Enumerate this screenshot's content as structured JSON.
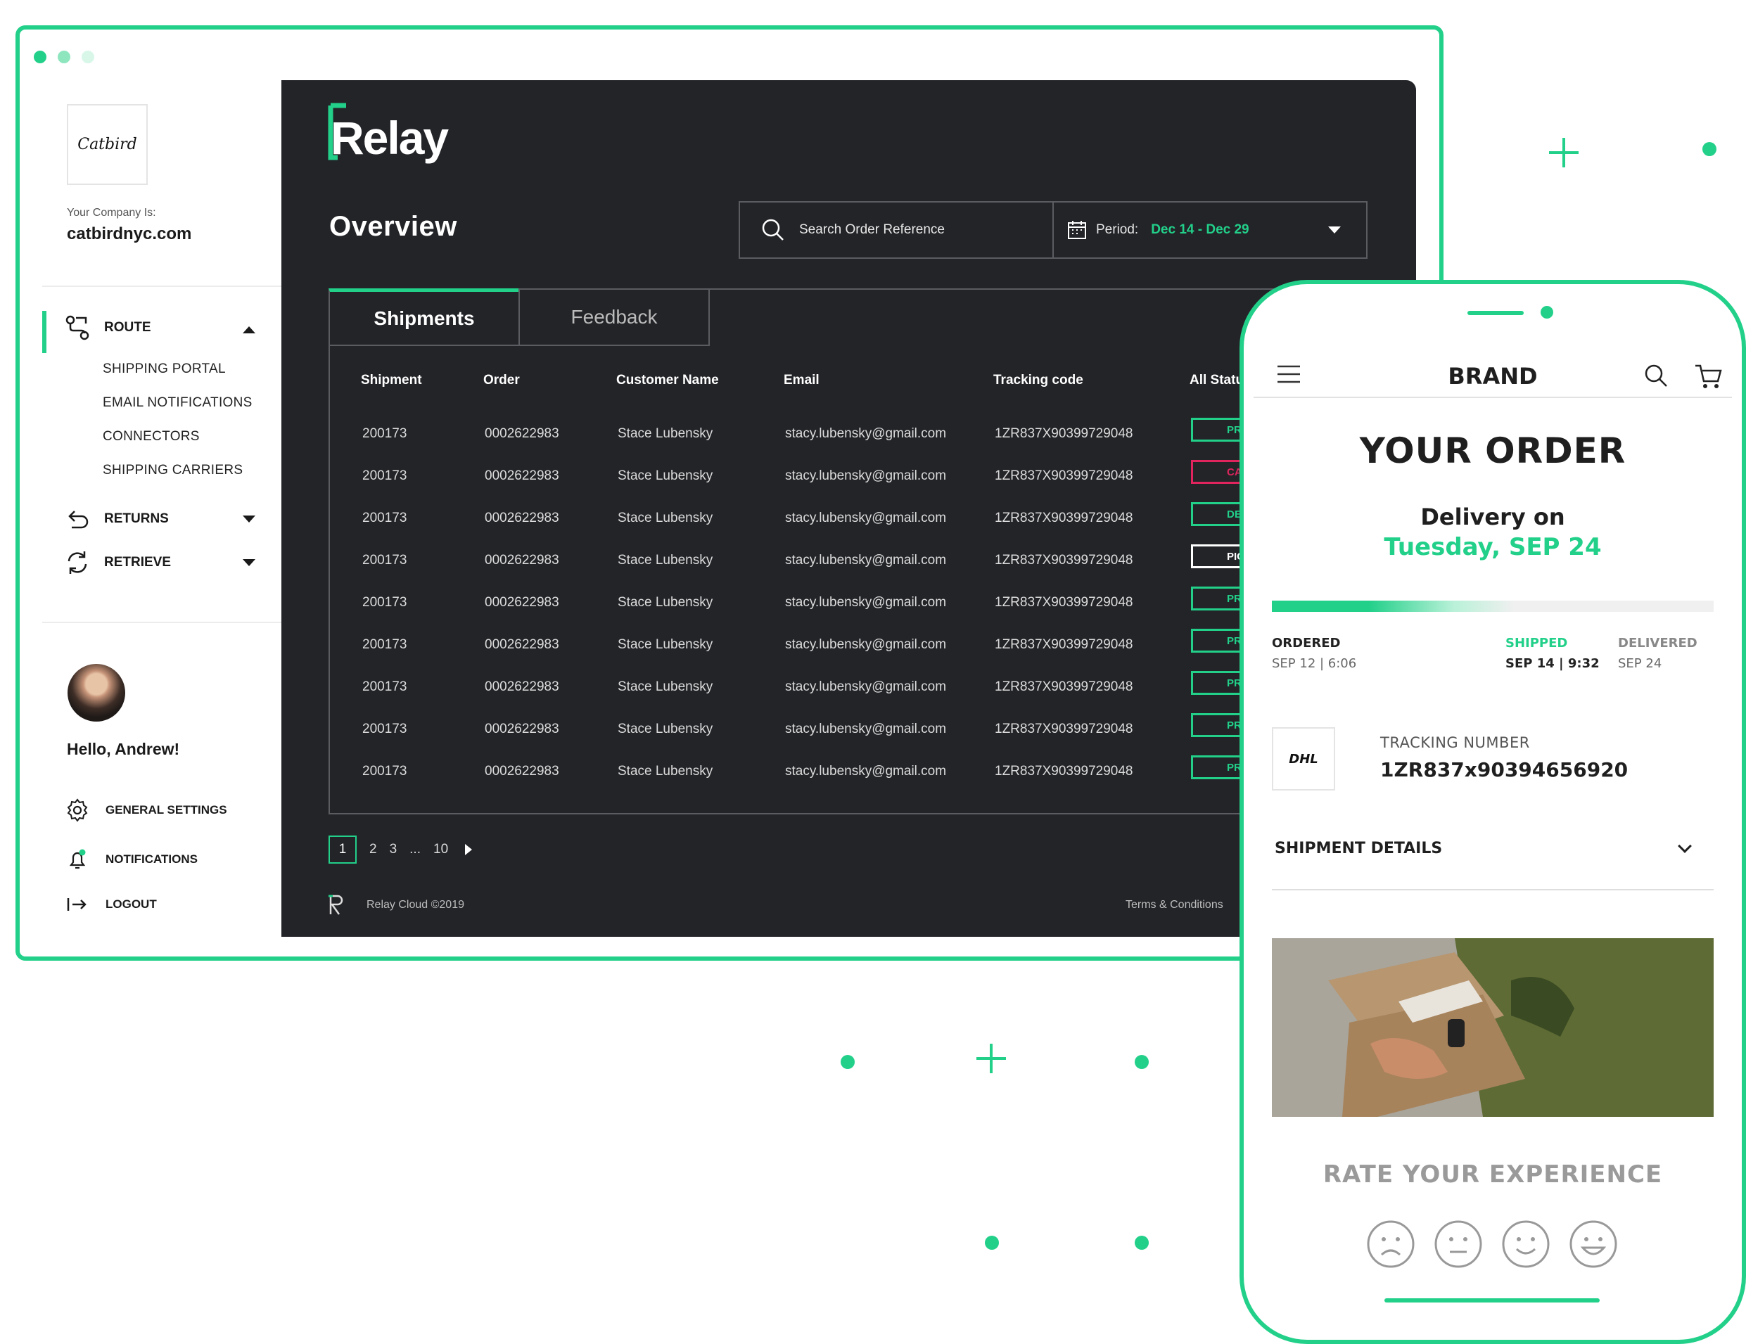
{
  "colors": {
    "accent": "#22d08a",
    "dark": "#232428",
    "cancel": "#e0245e"
  },
  "sidebar": {
    "company_logo": "Catbird",
    "company_label": "Your Company Is:",
    "company_name": "catbirdnyc.com",
    "route_label": "ROUTE",
    "route_items": [
      "SHIPPING PORTAL",
      "EMAIL NOTIFICATIONS",
      "CONNECTORS",
      "SHIPPING CARRIERS"
    ],
    "returns_label": "RETURNS",
    "retrieve_label": "RETRIEVE",
    "greeting": "Hello, Andrew!",
    "general_settings": "GENERAL SETTINGS",
    "notifications": "NOTIFICATIONS",
    "logout": "LOGOUT"
  },
  "main": {
    "brand": "Relay",
    "title": "Overview",
    "search_placeholder": "Search Order Reference",
    "period_label": "Period:",
    "period_value": "Dec 14 - Dec 29",
    "tabs": [
      "Shipments",
      "Feedback"
    ],
    "columns": [
      "Shipment",
      "Order",
      "Customer Name",
      "Email",
      "Tracking code",
      "All Statu"
    ],
    "rows": [
      {
        "shipment": "200173",
        "order": "0002622983",
        "name": "Stace Lubensky",
        "email": "stacy.lubensky@gmail.com",
        "tracking": "1ZR837X90399729048",
        "status": "PR",
        "status_color": "#22d08a"
      },
      {
        "shipment": "200173",
        "order": "0002622983",
        "name": "Stace Lubensky",
        "email": "stacy.lubensky@gmail.com",
        "tracking": "1ZR837X90399729048",
        "status": "CA",
        "status_color": "#e0245e"
      },
      {
        "shipment": "200173",
        "order": "0002622983",
        "name": "Stace Lubensky",
        "email": "stacy.lubensky@gmail.com",
        "tracking": "1ZR837X90399729048",
        "status": "DE",
        "status_color": "#22d08a"
      },
      {
        "shipment": "200173",
        "order": "0002622983",
        "name": "Stace Lubensky",
        "email": "stacy.lubensky@gmail.com",
        "tracking": "1ZR837X90399729048",
        "status": "PIC",
        "status_color": "#ffffff"
      },
      {
        "shipment": "200173",
        "order": "0002622983",
        "name": "Stace Lubensky",
        "email": "stacy.lubensky@gmail.com",
        "tracking": "1ZR837X90399729048",
        "status": "PR",
        "status_color": "#22d08a"
      },
      {
        "shipment": "200173",
        "order": "0002622983",
        "name": "Stace Lubensky",
        "email": "stacy.lubensky@gmail.com",
        "tracking": "1ZR837X90399729048",
        "status": "PRO",
        "status_color": "#22d08a"
      },
      {
        "shipment": "200173",
        "order": "0002622983",
        "name": "Stace Lubensky",
        "email": "stacy.lubensky@gmail.com",
        "tracking": "1ZR837X90399729048",
        "status": "PRO",
        "status_color": "#22d08a"
      },
      {
        "shipment": "200173",
        "order": "0002622983",
        "name": "Stace Lubensky",
        "email": "stacy.lubensky@gmail.com",
        "tracking": "1ZR837X90399729048",
        "status": "PRO",
        "status_color": "#22d08a"
      },
      {
        "shipment": "200173",
        "order": "0002622983",
        "name": "Stace Lubensky",
        "email": "stacy.lubensky@gmail.com",
        "tracking": "1ZR837X90399729048",
        "status": "PRO",
        "status_color": "#22d08a"
      }
    ],
    "pagination": {
      "current": "1",
      "p2": "2",
      "p3": "3",
      "ellipsis": "...",
      "last": "10"
    },
    "footer": {
      "copyright": "Relay Cloud ©2019",
      "terms": "Terms & Conditions"
    }
  },
  "phone": {
    "brand": "BRAND",
    "title": "YOUR ORDER",
    "delivery_label": "Delivery on",
    "delivery_date": "Tuesday, SEP 24",
    "progress": 0.55,
    "steps": [
      {
        "label": "ORDERED",
        "value": "SEP 12 | 6:06"
      },
      {
        "label": "SHIPPED",
        "value": "SEP 14 | 9:32"
      },
      {
        "label": "DELIVERED",
        "value": "SEP 24"
      }
    ],
    "carrier_logo": "DHL",
    "tracking_label": "TRACKING NUMBER",
    "tracking_number": "1ZR837x90394656920",
    "shipment_details": "SHIPMENT DETAILS",
    "rate_label": "RATE YOUR EXPERIENCE"
  }
}
